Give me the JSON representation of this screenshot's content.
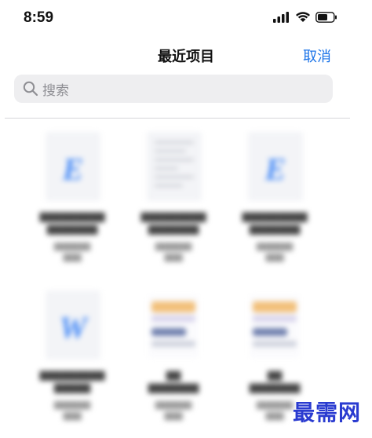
{
  "status_bar": {
    "time": "8:59",
    "icons": [
      "signal-icon",
      "wifi-icon",
      "battery-icon"
    ]
  },
  "nav": {
    "title": "最近项目",
    "cancel_label": "取消"
  },
  "search": {
    "placeholder": "搜索"
  },
  "colors": {
    "accent": "#1a73e8",
    "watermark": "#2a3bd0"
  },
  "files": [
    {
      "type": "pdf-icon"
    },
    {
      "type": "document-preview"
    },
    {
      "type": "pdf-icon"
    },
    {
      "type": "word-icon"
    },
    {
      "type": "image-preview"
    },
    {
      "type": "image-preview"
    }
  ],
  "watermark": "最需网"
}
